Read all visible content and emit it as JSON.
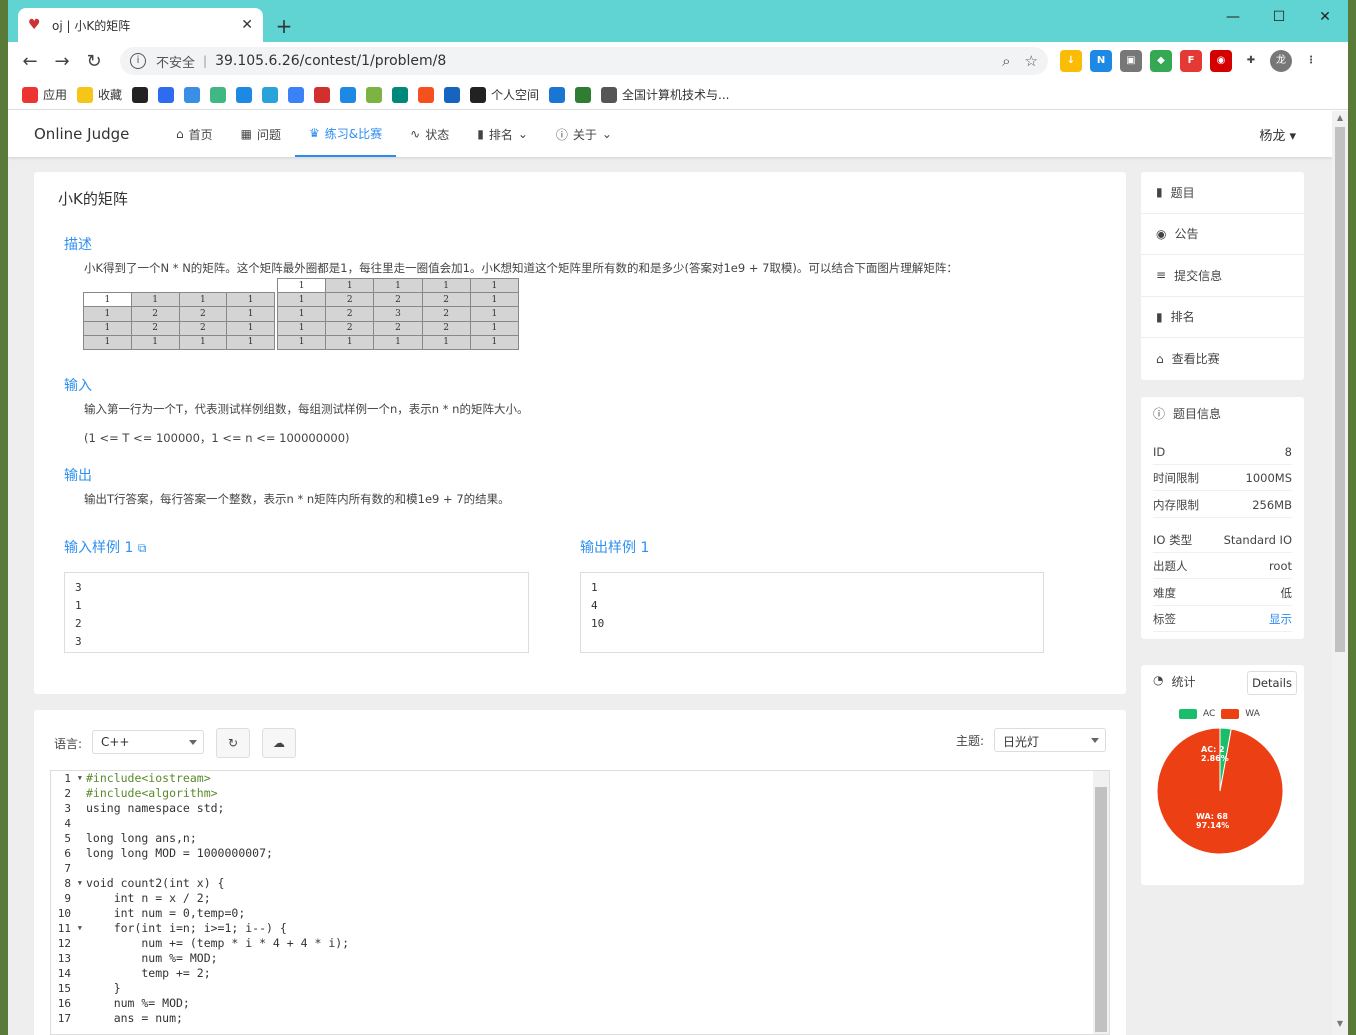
{
  "browser": {
    "tab_title": "oj | 小K的矩阵",
    "insecure_label": "不安全",
    "url": "39.105.6.26/contest/1/problem/8",
    "avatar_label": "龙",
    "bookmarks": [
      {
        "label": "应用",
        "color": "#e33"
      },
      {
        "label": "收藏",
        "color": "#f5c518"
      },
      {
        "label": "",
        "color": "#222"
      },
      {
        "label": "",
        "color": "#2d6cf0"
      },
      {
        "label": "",
        "color": "#3a8ee6"
      },
      {
        "label": "",
        "color": "#41b883"
      },
      {
        "label": "",
        "color": "#1e88e5"
      },
      {
        "label": "",
        "color": "#29a3d9"
      },
      {
        "label": "",
        "color": "#3b82f6"
      },
      {
        "label": "",
        "color": "#d32f2f"
      },
      {
        "label": "",
        "color": "#1e88e5"
      },
      {
        "label": "",
        "color": "#7cb342"
      },
      {
        "label": "",
        "color": "#00897b"
      },
      {
        "label": "",
        "color": "#f4511e"
      },
      {
        "label": "",
        "color": "#1565c0"
      },
      {
        "label": "个人空间",
        "color": "#222"
      },
      {
        "label": "",
        "color": "#1976d2"
      },
      {
        "label": "",
        "color": "#2e7d32"
      },
      {
        "label": "全国计算机技术与...",
        "color": "#555"
      }
    ]
  },
  "nav": {
    "brand": "Online Judge",
    "items": [
      {
        "label": "首页",
        "icon": "⌂"
      },
      {
        "label": "问题",
        "icon": "▦"
      },
      {
        "label": "练习&比赛",
        "icon": "♛"
      },
      {
        "label": "状态",
        "icon": "∿"
      },
      {
        "label": "排名",
        "icon": "▮"
      },
      {
        "label": "关于",
        "icon": "ⓘ"
      }
    ],
    "user": "杨龙"
  },
  "problem": {
    "title": "小K的矩阵",
    "description_title": "描述",
    "description": "小K得到了一个N * N的矩阵。这个矩阵最外圈都是1，每往里走一圈值会加1。小K想知道这个矩阵里所有数的和是多少(答案对1e9 + 7取模)。可以结合下面图片理解矩阵：",
    "matrix4": [
      [
        "1",
        "1",
        "1",
        "1"
      ],
      [
        "1",
        "2",
        "2",
        "1"
      ],
      [
        "1",
        "2",
        "2",
        "1"
      ],
      [
        "1",
        "1",
        "1",
        "1"
      ]
    ],
    "matrix5": [
      [
        "1",
        "1",
        "1",
        "1",
        "1"
      ],
      [
        "1",
        "2",
        "2",
        "2",
        "1"
      ],
      [
        "1",
        "2",
        "3",
        "2",
        "1"
      ],
      [
        "1",
        "2",
        "2",
        "2",
        "1"
      ],
      [
        "1",
        "1",
        "1",
        "1",
        "1"
      ]
    ],
    "input_title": "输入",
    "input_text": "输入第一行为一个T，代表测试样例组数，每组测试样例一个n，表示n * n的矩阵大小。",
    "input_range": "(1 <= T <= 100000，1 <= n <= 100000000)",
    "output_title": "输出",
    "output_text": "输出T行答案，每行答案一个整数，表示n * n矩阵内所有数的和模1e9 + 7的结果。",
    "sample_input_title": "输入样例 1",
    "sample_input": "3\n1\n2\n3",
    "sample_output_title": "输出样例 1",
    "sample_output": "1\n4\n10"
  },
  "editor": {
    "language_label": "语言:",
    "language": "C++",
    "theme_label": "主题:",
    "theme": "日光灯",
    "code_lines": [
      "#include<iostream>",
      "#include<algorithm>",
      "using namespace std;",
      "",
      "long long ans,n;",
      "long long MOD = 1000000007;",
      "",
      "void count2(int x) {",
      "    int n = x / 2;",
      "    int num = 0,temp=0;",
      "    for(int i=n; i>=1; i--) {",
      "        num += (temp * i * 4 + 4 * i);",
      "        num %= MOD;",
      "        temp += 2;",
      "    }",
      "    num %= MOD;",
      "    ans = num;"
    ],
    "line_numbers": [
      "1",
      "2",
      "3",
      "4",
      "5",
      "6",
      "7",
      "8",
      "9",
      "10",
      "11",
      "12",
      "13",
      "14",
      "15",
      "16",
      "17"
    ]
  },
  "sidebar": {
    "menu": [
      {
        "label": "题目",
        "icon": "▮"
      },
      {
        "label": "公告",
        "icon": "◉"
      },
      {
        "label": "提交信息",
        "icon": "≡"
      },
      {
        "label": "排名",
        "icon": "▮"
      },
      {
        "label": "查看比赛",
        "icon": "⌂"
      }
    ],
    "info_title": "题目信息",
    "info": [
      {
        "key": "ID",
        "value": "8"
      },
      {
        "key": "时间限制",
        "value": "1000MS"
      },
      {
        "key": "内存限制",
        "value": "256MB"
      },
      {
        "key": "IO 类型",
        "value": "Standard IO"
      },
      {
        "key": "出题人",
        "value": "root"
      },
      {
        "key": "难度",
        "value": "低"
      },
      {
        "key": "标签",
        "value": "显示"
      }
    ],
    "stats_title": "统计",
    "details_label": "Details"
  },
  "chart_data": {
    "type": "pie",
    "categories": [
      "AC",
      "WA"
    ],
    "values": [
      2,
      68
    ],
    "percent_labels": [
      "2.86%",
      "97.14%"
    ],
    "slice_labels": [
      "AC: 2",
      "WA: 68"
    ],
    "colors": [
      "#19be6b",
      "#ed3f14"
    ],
    "legend": "top"
  }
}
